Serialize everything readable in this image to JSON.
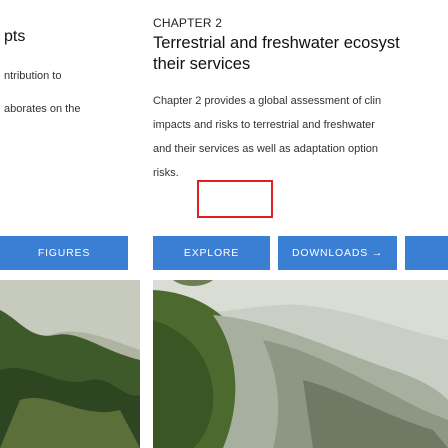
{
  "left_card": {
    "title_fragment": "pts",
    "line1": "ntribution to",
    "line2": "aborates on the",
    "button_label": "FIGURES"
  },
  "chapter_card": {
    "label": "CHAPTER 2",
    "title_line1": "Terrestrial and freshwater ecosyst",
    "title_line2": "their services",
    "description_lines": [
      "Chapter 2 provides a global assessment of clin",
      "impacts and risks to terrestrial and freshwater",
      "and their services as well as adaptation option",
      "risks."
    ],
    "buttons": {
      "explore": "EXPLORE",
      "downloads": "DOWNLOADS →"
    }
  },
  "colors": {
    "button_blue": "#3b7fd4",
    "focus_outline": "#e02020"
  }
}
